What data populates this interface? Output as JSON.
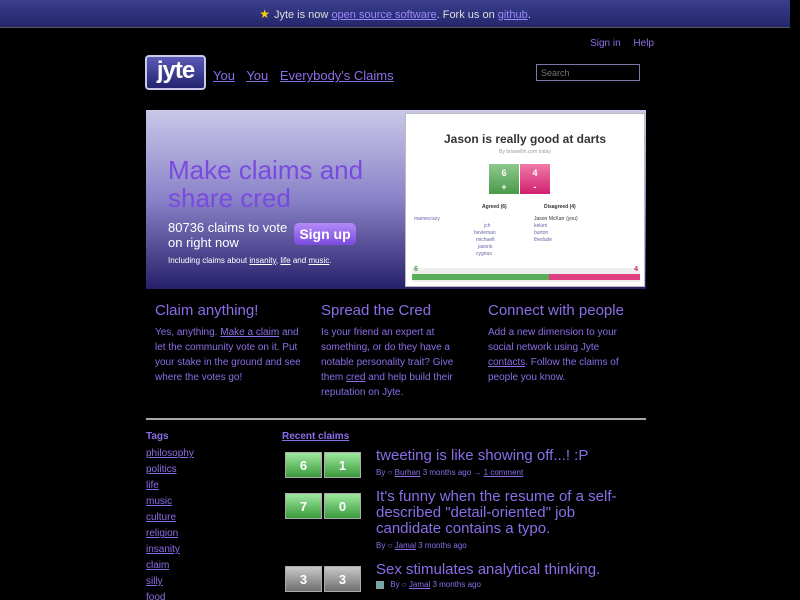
{
  "topbar": {
    "text_before": "Jyte is now",
    "link_open_source": "open source software",
    "text_middle": ". Fork us on",
    "link_github": "github",
    "text_end": "."
  },
  "toplinks": {
    "signin": "Sign in",
    "help": "Help"
  },
  "logo": {
    "text": "jyte"
  },
  "nav": {
    "you1": "You",
    "you2": "You",
    "everybody": "Everybody's Claims"
  },
  "search": {
    "placeholder": "Search"
  },
  "hero": {
    "title": "Make claims and share cred",
    "count_line": "80736 claims to vote on right now",
    "signup": "Sign up",
    "about_prefix": "Including claims about",
    "topic1": "insanity",
    "topic2": "life",
    "topic3": "music",
    "about_and": "and",
    "sample_card": {
      "title": "Jason is really good at darts",
      "byline": "By brianellin.com today",
      "agreed_votes": "6",
      "agreed_sign": "+",
      "disagreed_votes": "4",
      "disagreed_sign": "-",
      "agreed_label": "Agreed (6)",
      "disagreed_label": "Disagreed (4)",
      "agreed_users": [
        "mamecrazy",
        "jch",
        "bevleman",
        "michaelt",
        "jasonk",
        "cygnus"
      ],
      "disagreed_users": [
        "Jason McKarr (you)",
        "kelum",
        "burton",
        "thedude"
      ],
      "bar_left": "6",
      "bar_right": "4",
      "agree_fraction": 0.6
    }
  },
  "features": [
    {
      "title": "Claim anything!",
      "text_pre": "Yes, anything.",
      "link": "Make a claim",
      "text_post": "and let the community vote on it. Put your stake in the ground and see where the votes go!"
    },
    {
      "title": "Spread the Cred",
      "text_pre": "Is your friend an expert at something, or do they have a notable personality trait? Give them",
      "link": "cred",
      "text_post": "and help build their reputation on Jyte."
    },
    {
      "title": "Connect with people",
      "text_pre": "Add a new dimension to your social network using Jyte",
      "link": "contacts",
      "text_post": ". Follow the claims of people you know."
    }
  ],
  "tags": {
    "title": "Tags",
    "items": [
      "philosophy",
      "politics",
      "life",
      "music",
      "culture",
      "religion",
      "insanity",
      "claim",
      "silly",
      "food"
    ]
  },
  "recent": {
    "title": "Recent claims",
    "claims": [
      {
        "agree": "6",
        "disagree": "1",
        "text": "tweeting is like showing off...! :P",
        "by": "By",
        "author": "Burhan",
        "when": "3 months ago",
        "arrow": "→",
        "comments": "1 comment"
      },
      {
        "agree": "7",
        "disagree": "0",
        "text": "It's funny when the resume of a self-described \"detail-oriented\" job candidate contains a typo.",
        "by": "By",
        "author": "Jamal",
        "when": "3 months ago"
      },
      {
        "agree": "3",
        "disagree": "3",
        "text": "Sex stimulates analytical thinking.",
        "by": "By",
        "author": "Jamal",
        "when": "3 months ago"
      }
    ]
  }
}
